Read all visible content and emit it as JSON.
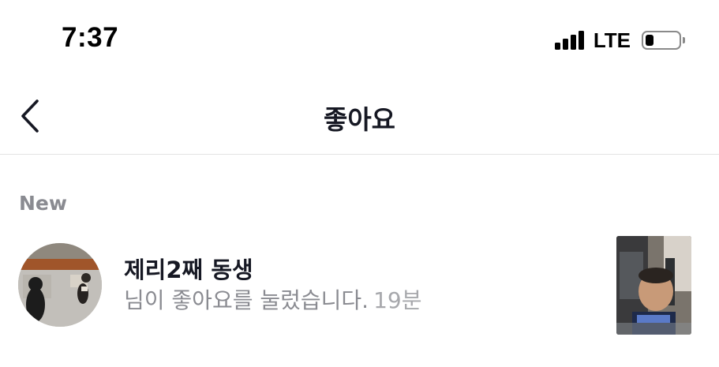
{
  "status_bar": {
    "time": "7:37",
    "network": "LTE",
    "battery_level": 0.25,
    "signal_bars": 4
  },
  "header": {
    "title": "좋아요",
    "back_icon": "chevron-left-icon"
  },
  "sections": [
    {
      "label": "New",
      "items": [
        {
          "username": "제리2째 동생",
          "message": "님이 좋아요를 눌렀습니다.",
          "time": "19분"
        }
      ]
    }
  ],
  "colors": {
    "primary_text": "#161823",
    "secondary_text": "#8a8b91",
    "divider": "#e3e3e4",
    "background": "#ffffff"
  }
}
